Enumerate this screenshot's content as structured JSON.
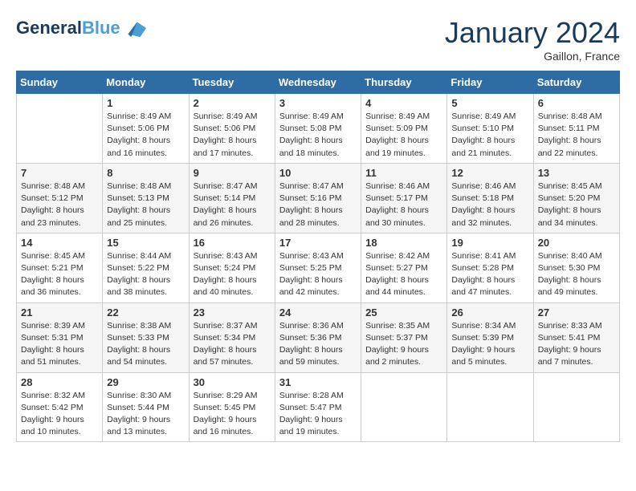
{
  "header": {
    "logo_line1": "General",
    "logo_line2": "Blue",
    "month": "January 2024",
    "location": "Gaillon, France"
  },
  "weekdays": [
    "Sunday",
    "Monday",
    "Tuesday",
    "Wednesday",
    "Thursday",
    "Friday",
    "Saturday"
  ],
  "weeks": [
    [
      {
        "day": "",
        "sunrise": "",
        "sunset": "",
        "daylight": ""
      },
      {
        "day": "1",
        "sunrise": "Sunrise: 8:49 AM",
        "sunset": "Sunset: 5:06 PM",
        "daylight": "Daylight: 8 hours and 16 minutes."
      },
      {
        "day": "2",
        "sunrise": "Sunrise: 8:49 AM",
        "sunset": "Sunset: 5:06 PM",
        "daylight": "Daylight: 8 hours and 17 minutes."
      },
      {
        "day": "3",
        "sunrise": "Sunrise: 8:49 AM",
        "sunset": "Sunset: 5:08 PM",
        "daylight": "Daylight: 8 hours and 18 minutes."
      },
      {
        "day": "4",
        "sunrise": "Sunrise: 8:49 AM",
        "sunset": "Sunset: 5:09 PM",
        "daylight": "Daylight: 8 hours and 19 minutes."
      },
      {
        "day": "5",
        "sunrise": "Sunrise: 8:49 AM",
        "sunset": "Sunset: 5:10 PM",
        "daylight": "Daylight: 8 hours and 21 minutes."
      },
      {
        "day": "6",
        "sunrise": "Sunrise: 8:48 AM",
        "sunset": "Sunset: 5:11 PM",
        "daylight": "Daylight: 8 hours and 22 minutes."
      }
    ],
    [
      {
        "day": "7",
        "sunrise": "Sunrise: 8:48 AM",
        "sunset": "Sunset: 5:12 PM",
        "daylight": "Daylight: 8 hours and 23 minutes."
      },
      {
        "day": "8",
        "sunrise": "Sunrise: 8:48 AM",
        "sunset": "Sunset: 5:13 PM",
        "daylight": "Daylight: 8 hours and 25 minutes."
      },
      {
        "day": "9",
        "sunrise": "Sunrise: 8:47 AM",
        "sunset": "Sunset: 5:14 PM",
        "daylight": "Daylight: 8 hours and 26 minutes."
      },
      {
        "day": "10",
        "sunrise": "Sunrise: 8:47 AM",
        "sunset": "Sunset: 5:16 PM",
        "daylight": "Daylight: 8 hours and 28 minutes."
      },
      {
        "day": "11",
        "sunrise": "Sunrise: 8:46 AM",
        "sunset": "Sunset: 5:17 PM",
        "daylight": "Daylight: 8 hours and 30 minutes."
      },
      {
        "day": "12",
        "sunrise": "Sunrise: 8:46 AM",
        "sunset": "Sunset: 5:18 PM",
        "daylight": "Daylight: 8 hours and 32 minutes."
      },
      {
        "day": "13",
        "sunrise": "Sunrise: 8:45 AM",
        "sunset": "Sunset: 5:20 PM",
        "daylight": "Daylight: 8 hours and 34 minutes."
      }
    ],
    [
      {
        "day": "14",
        "sunrise": "Sunrise: 8:45 AM",
        "sunset": "Sunset: 5:21 PM",
        "daylight": "Daylight: 8 hours and 36 minutes."
      },
      {
        "day": "15",
        "sunrise": "Sunrise: 8:44 AM",
        "sunset": "Sunset: 5:22 PM",
        "daylight": "Daylight: 8 hours and 38 minutes."
      },
      {
        "day": "16",
        "sunrise": "Sunrise: 8:43 AM",
        "sunset": "Sunset: 5:24 PM",
        "daylight": "Daylight: 8 hours and 40 minutes."
      },
      {
        "day": "17",
        "sunrise": "Sunrise: 8:43 AM",
        "sunset": "Sunset: 5:25 PM",
        "daylight": "Daylight: 8 hours and 42 minutes."
      },
      {
        "day": "18",
        "sunrise": "Sunrise: 8:42 AM",
        "sunset": "Sunset: 5:27 PM",
        "daylight": "Daylight: 8 hours and 44 minutes."
      },
      {
        "day": "19",
        "sunrise": "Sunrise: 8:41 AM",
        "sunset": "Sunset: 5:28 PM",
        "daylight": "Daylight: 8 hours and 47 minutes."
      },
      {
        "day": "20",
        "sunrise": "Sunrise: 8:40 AM",
        "sunset": "Sunset: 5:30 PM",
        "daylight": "Daylight: 8 hours and 49 minutes."
      }
    ],
    [
      {
        "day": "21",
        "sunrise": "Sunrise: 8:39 AM",
        "sunset": "Sunset: 5:31 PM",
        "daylight": "Daylight: 8 hours and 51 minutes."
      },
      {
        "day": "22",
        "sunrise": "Sunrise: 8:38 AM",
        "sunset": "Sunset: 5:33 PM",
        "daylight": "Daylight: 8 hours and 54 minutes."
      },
      {
        "day": "23",
        "sunrise": "Sunrise: 8:37 AM",
        "sunset": "Sunset: 5:34 PM",
        "daylight": "Daylight: 8 hours and 57 minutes."
      },
      {
        "day": "24",
        "sunrise": "Sunrise: 8:36 AM",
        "sunset": "Sunset: 5:36 PM",
        "daylight": "Daylight: 8 hours and 59 minutes."
      },
      {
        "day": "25",
        "sunrise": "Sunrise: 8:35 AM",
        "sunset": "Sunset: 5:37 PM",
        "daylight": "Daylight: 9 hours and 2 minutes."
      },
      {
        "day": "26",
        "sunrise": "Sunrise: 8:34 AM",
        "sunset": "Sunset: 5:39 PM",
        "daylight": "Daylight: 9 hours and 5 minutes."
      },
      {
        "day": "27",
        "sunrise": "Sunrise: 8:33 AM",
        "sunset": "Sunset: 5:41 PM",
        "daylight": "Daylight: 9 hours and 7 minutes."
      }
    ],
    [
      {
        "day": "28",
        "sunrise": "Sunrise: 8:32 AM",
        "sunset": "Sunset: 5:42 PM",
        "daylight": "Daylight: 9 hours and 10 minutes."
      },
      {
        "day": "29",
        "sunrise": "Sunrise: 8:30 AM",
        "sunset": "Sunset: 5:44 PM",
        "daylight": "Daylight: 9 hours and 13 minutes."
      },
      {
        "day": "30",
        "sunrise": "Sunrise: 8:29 AM",
        "sunset": "Sunset: 5:45 PM",
        "daylight": "Daylight: 9 hours and 16 minutes."
      },
      {
        "day": "31",
        "sunrise": "Sunrise: 8:28 AM",
        "sunset": "Sunset: 5:47 PM",
        "daylight": "Daylight: 9 hours and 19 minutes."
      },
      {
        "day": "",
        "sunrise": "",
        "sunset": "",
        "daylight": ""
      },
      {
        "day": "",
        "sunrise": "",
        "sunset": "",
        "daylight": ""
      },
      {
        "day": "",
        "sunrise": "",
        "sunset": "",
        "daylight": ""
      }
    ]
  ]
}
